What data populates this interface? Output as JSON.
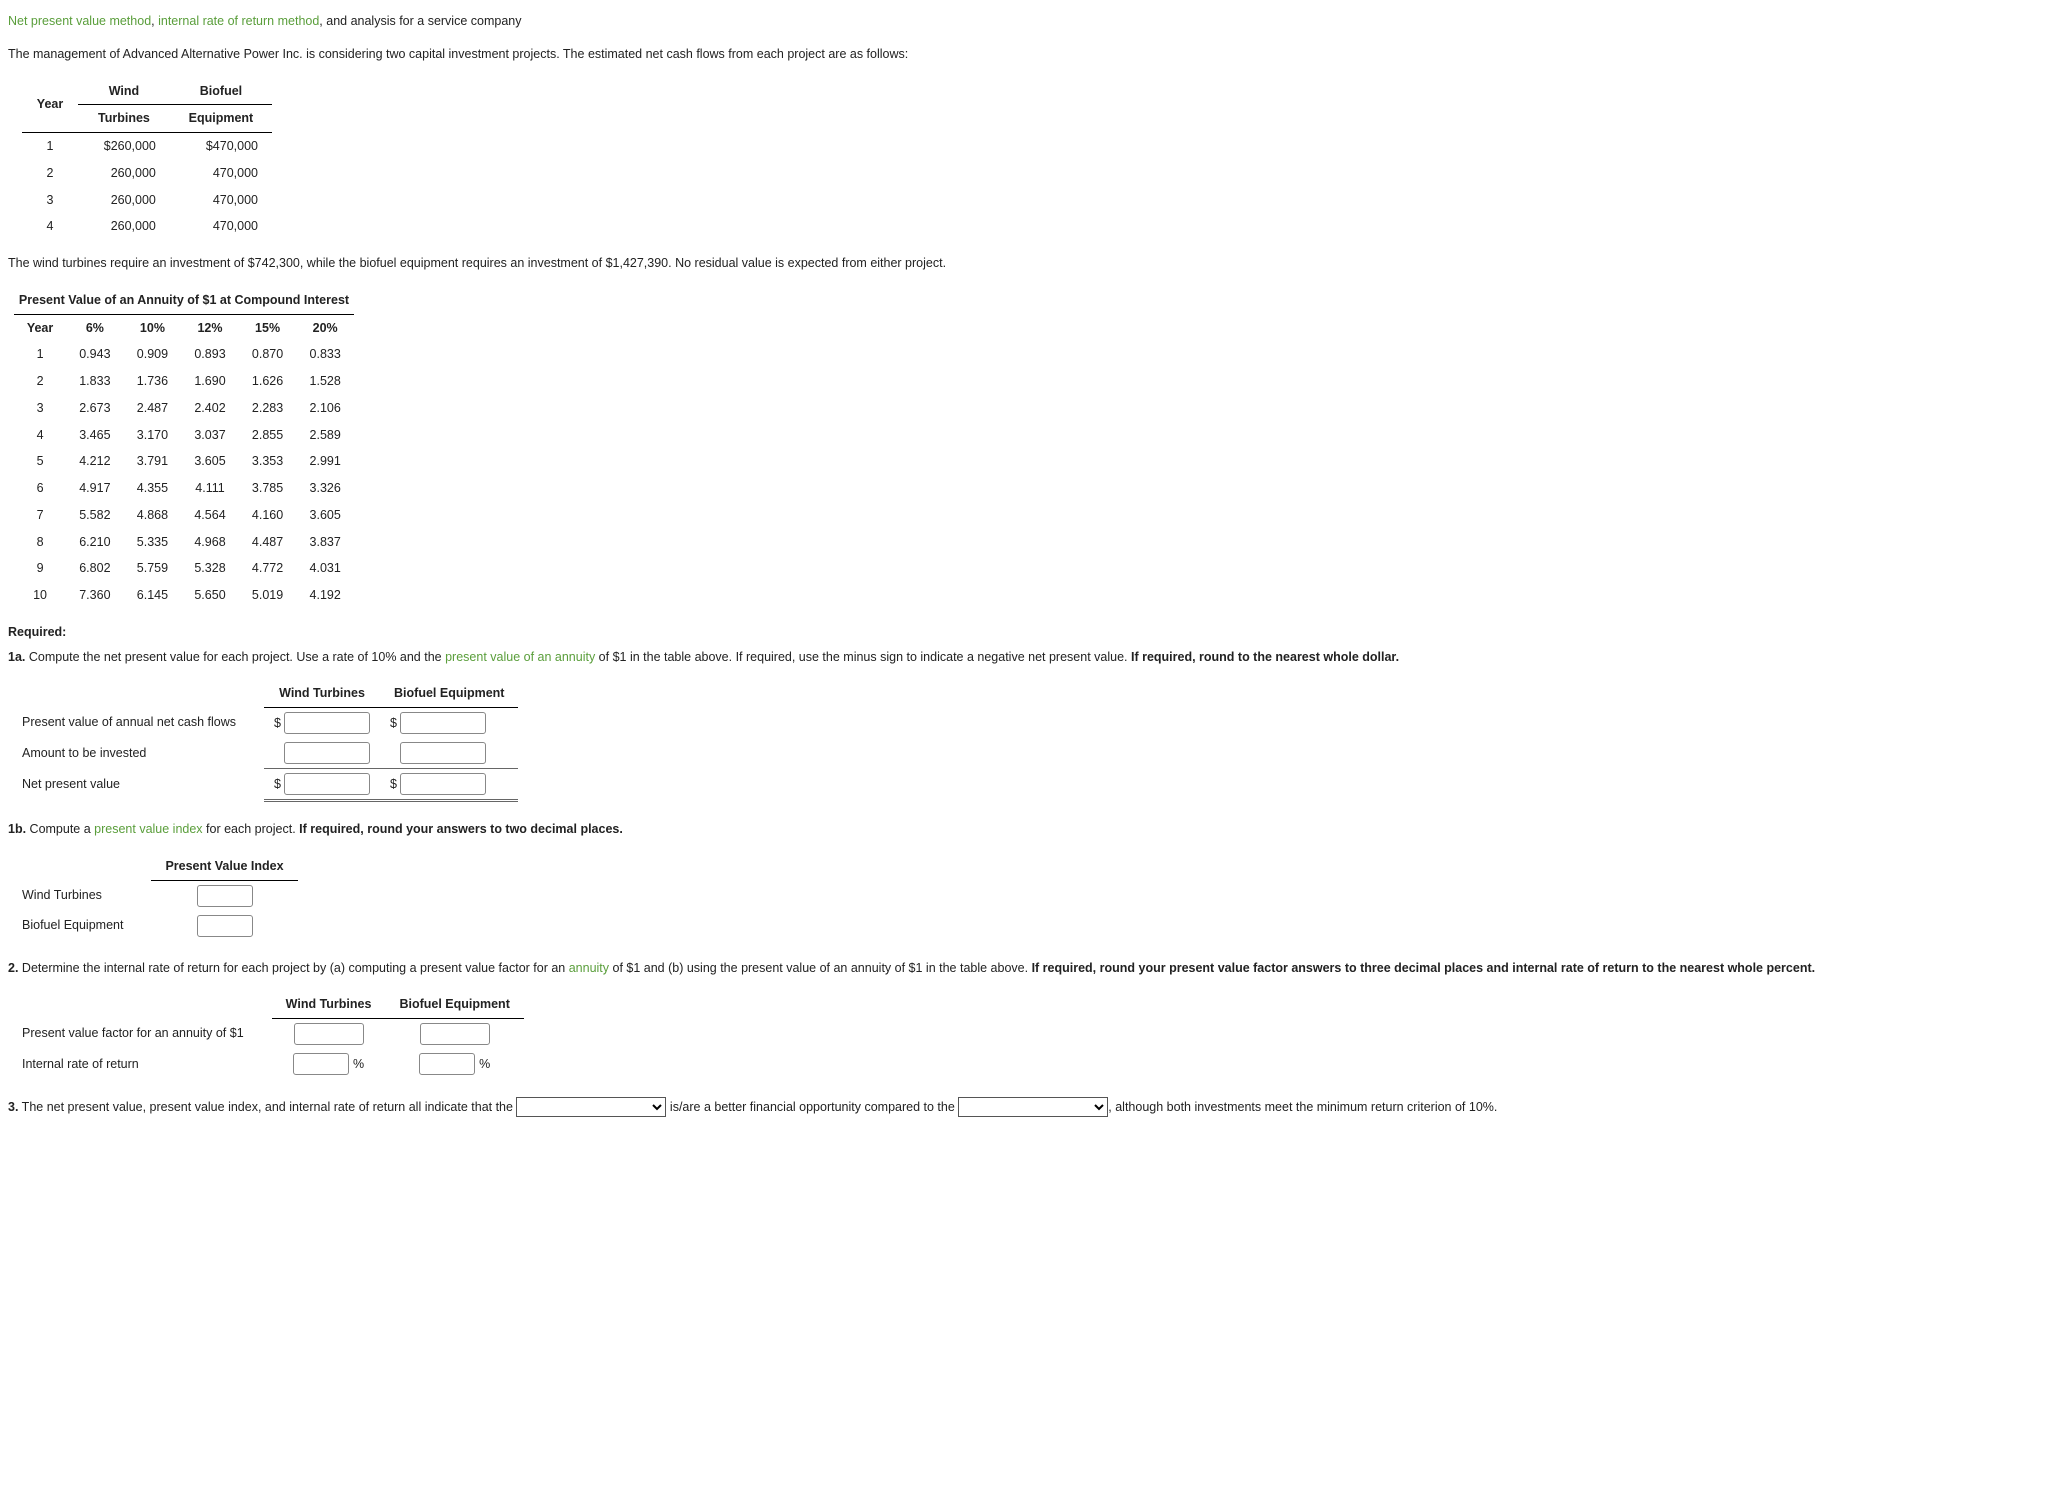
{
  "title_line": {
    "term1": "Net present value method",
    "term2": "internal rate of return method",
    "rest": ", and analysis for a service company"
  },
  "intro": "The management of Advanced Alternative Power Inc. is considering two capital investment projects. The estimated net cash flows from each project are as follows:",
  "cash_flows": {
    "headers": {
      "year": "Year",
      "c1a": "Wind",
      "c1b": "Turbines",
      "c2a": "Biofuel",
      "c2b": "Equipment"
    },
    "rows": [
      {
        "year": "1",
        "wind": "$260,000",
        "bio": "$470,000"
      },
      {
        "year": "2",
        "wind": "260,000",
        "bio": "470,000"
      },
      {
        "year": "3",
        "wind": "260,000",
        "bio": "470,000"
      },
      {
        "year": "4",
        "wind": "260,000",
        "bio": "470,000"
      }
    ]
  },
  "investment": "The wind turbines require an investment of $742,300, while the biofuel equipment requires an investment of $1,427,390. No residual value is expected from either project.",
  "annuity": {
    "title": "Present Value of an Annuity of $1 at Compound Interest",
    "headers": {
      "year": "Year",
      "c1": "6%",
      "c2": "10%",
      "c3": "12%",
      "c4": "15%",
      "c5": "20%"
    },
    "rows": [
      {
        "y": "1",
        "a": "0.943",
        "b": "0.909",
        "c": "0.893",
        "d": "0.870",
        "e": "0.833"
      },
      {
        "y": "2",
        "a": "1.833",
        "b": "1.736",
        "c": "1.690",
        "d": "1.626",
        "e": "1.528"
      },
      {
        "y": "3",
        "a": "2.673",
        "b": "2.487",
        "c": "2.402",
        "d": "2.283",
        "e": "2.106"
      },
      {
        "y": "4",
        "a": "3.465",
        "b": "3.170",
        "c": "3.037",
        "d": "2.855",
        "e": "2.589"
      },
      {
        "y": "5",
        "a": "4.212",
        "b": "3.791",
        "c": "3.605",
        "d": "3.353",
        "e": "2.991"
      },
      {
        "y": "6",
        "a": "4.917",
        "b": "4.355",
        "c": "4.111",
        "d": "3.785",
        "e": "3.326"
      },
      {
        "y": "7",
        "a": "5.582",
        "b": "4.868",
        "c": "4.564",
        "d": "4.160",
        "e": "3.605"
      },
      {
        "y": "8",
        "a": "6.210",
        "b": "5.335",
        "c": "4.968",
        "d": "4.487",
        "e": "3.837"
      },
      {
        "y": "9",
        "a": "6.802",
        "b": "5.759",
        "c": "5.328",
        "d": "4.772",
        "e": "4.031"
      },
      {
        "y": "10",
        "a": "7.360",
        "b": "6.145",
        "c": "5.650",
        "d": "5.019",
        "e": "4.192"
      }
    ]
  },
  "required_label": "Required:",
  "q1a": {
    "num": "1a.",
    "lead": " Compute the net present value for each project. Use a rate of 10% and the ",
    "term": "present value of an annuity",
    "mid": " of $1 in the table above. If required, use the minus sign to indicate a negative net present value. ",
    "bold": "If required, round to the nearest whole dollar."
  },
  "npv_table": {
    "h1": "Wind Turbines",
    "h2": "Biofuel Equipment",
    "r1": "Present value of annual net cash flows",
    "r2": "Amount to be invested",
    "r3": "Net present value",
    "dollar": "$"
  },
  "q1b": {
    "num": "1b.",
    "lead": " Compute a ",
    "term": "present value index",
    "mid": " for each project. ",
    "bold": "If required, round your answers to two decimal places."
  },
  "pvi_table": {
    "h1": "Present Value Index",
    "r1": "Wind Turbines",
    "r2": "Biofuel Equipment"
  },
  "q2": {
    "num": "2.",
    "lead": " Determine the internal rate of return for each project by (a) computing a present value factor for an ",
    "term": "annuity",
    "mid": " of $1 and (b) using the present value of an annuity of $1 in the table above. ",
    "bold": "If required, round your present value factor answers to three decimal places and internal rate of return to the nearest whole percent."
  },
  "irr_table": {
    "h1": "Wind Turbines",
    "h2": "Biofuel Equipment",
    "r1": "Present value factor for an annuity of $1",
    "r2": "Internal rate of return",
    "percent": "%"
  },
  "q3": {
    "num": "3.",
    "lead": " The net present value, present value index, and internal rate of return all indicate that the ",
    "mid": " is/are a better financial opportunity compared to the ",
    "tail": ", although both investments meet the minimum return criterion of 10%."
  }
}
